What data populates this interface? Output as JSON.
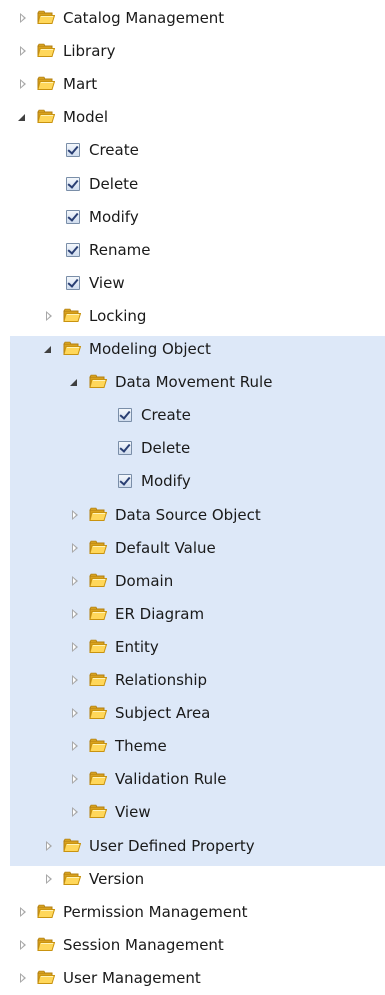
{
  "tree": [
    {
      "label": "Catalog Management",
      "type": "folder",
      "state": "collapsed",
      "level": 0
    },
    {
      "label": "Library",
      "type": "folder",
      "state": "collapsed",
      "level": 0
    },
    {
      "label": "Mart",
      "type": "folder",
      "state": "collapsed",
      "level": 0
    },
    {
      "label": "Model",
      "type": "folder",
      "state": "expanded",
      "level": 0
    },
    {
      "label": "Create",
      "type": "checkbox",
      "checked": true,
      "level": 1
    },
    {
      "label": "Delete",
      "type": "checkbox",
      "checked": true,
      "level": 1
    },
    {
      "label": "Modify",
      "type": "checkbox",
      "checked": true,
      "level": 1
    },
    {
      "label": "Rename",
      "type": "checkbox",
      "checked": true,
      "level": 1
    },
    {
      "label": "View",
      "type": "checkbox",
      "checked": true,
      "level": 1
    },
    {
      "label": "Locking",
      "type": "folder",
      "state": "collapsed",
      "level": 1
    },
    {
      "label": "Modeling Object",
      "type": "folder",
      "state": "expanded",
      "level": 1
    },
    {
      "label": "Data Movement Rule",
      "type": "folder",
      "state": "expanded",
      "level": 2
    },
    {
      "label": "Create",
      "type": "checkbox",
      "checked": true,
      "level": 3
    },
    {
      "label": "Delete",
      "type": "checkbox",
      "checked": true,
      "level": 3
    },
    {
      "label": "Modify",
      "type": "checkbox",
      "checked": true,
      "level": 3
    },
    {
      "label": "Data Source Object",
      "type": "folder",
      "state": "collapsed",
      "level": 2
    },
    {
      "label": "Default Value",
      "type": "folder",
      "state": "collapsed",
      "level": 2
    },
    {
      "label": "Domain",
      "type": "folder",
      "state": "collapsed",
      "level": 2
    },
    {
      "label": "ER Diagram",
      "type": "folder",
      "state": "collapsed",
      "level": 2
    },
    {
      "label": "Entity",
      "type": "folder",
      "state": "collapsed",
      "level": 2
    },
    {
      "label": "Relationship",
      "type": "folder",
      "state": "collapsed",
      "level": 2
    },
    {
      "label": "Subject Area",
      "type": "folder",
      "state": "collapsed",
      "level": 2
    },
    {
      "label": "Theme",
      "type": "folder",
      "state": "collapsed",
      "level": 2
    },
    {
      "label": "Validation Rule",
      "type": "folder",
      "state": "collapsed",
      "level": 2
    },
    {
      "label": "View",
      "type": "folder",
      "state": "collapsed",
      "level": 2
    },
    {
      "label": "User Defined Property",
      "type": "folder",
      "state": "collapsed",
      "level": 1
    },
    {
      "label": "Version",
      "type": "folder",
      "state": "collapsed",
      "level": 1
    },
    {
      "label": "Permission Management",
      "type": "folder",
      "state": "collapsed",
      "level": 0
    },
    {
      "label": "Session Management",
      "type": "folder",
      "state": "collapsed",
      "level": 0
    },
    {
      "label": "User Management",
      "type": "folder",
      "state": "collapsed",
      "level": 0
    }
  ],
  "colors": {
    "selection_background": "#dde8f8",
    "folder": "#f2c33a"
  },
  "icons": {
    "folder": "folder-icon",
    "checkbox": "checkbox-icon",
    "collapsed": "expand-arrow-icon",
    "expanded": "collapse-arrow-icon"
  }
}
